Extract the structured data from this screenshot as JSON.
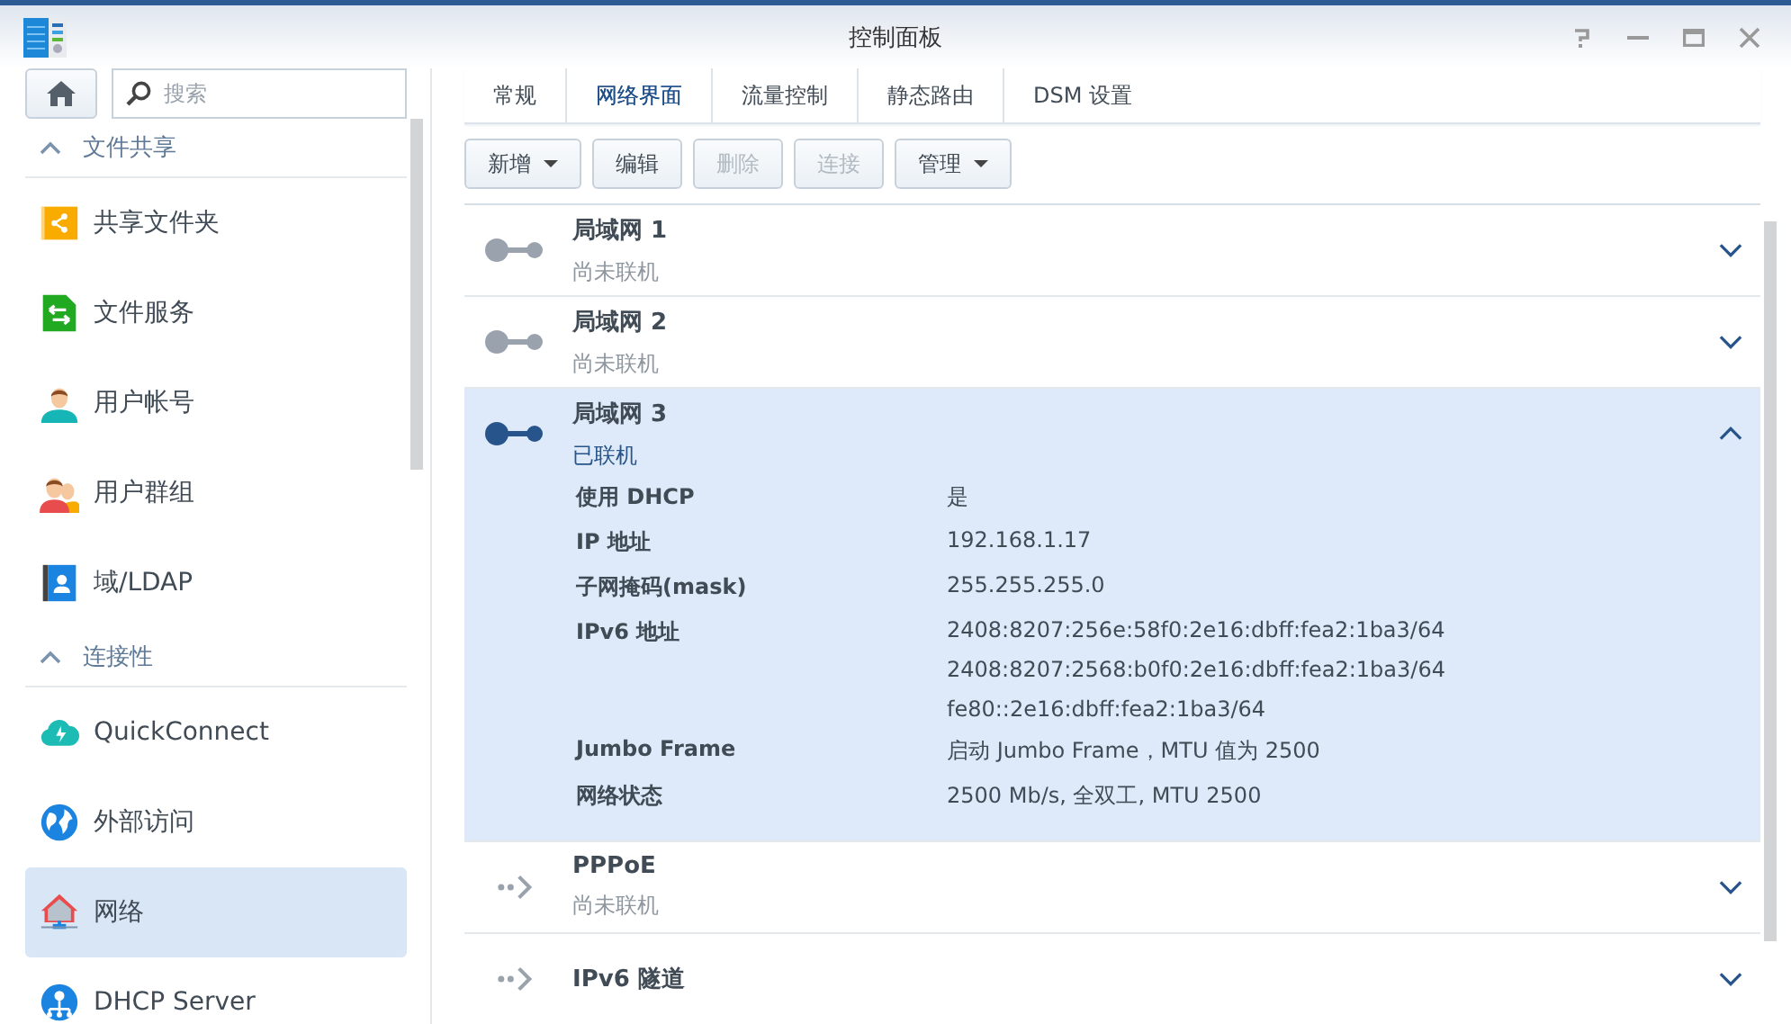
{
  "window": {
    "title": "控制面板"
  },
  "sidebar": {
    "search": {
      "placeholder": "搜索"
    },
    "sections": [
      {
        "title": "文件共享",
        "expanded": true,
        "items": [
          {
            "label": "共享文件夹",
            "kind": "folder",
            "selected": false
          },
          {
            "label": "文件服务",
            "kind": "fileservice",
            "selected": false
          },
          {
            "label": "用户帐号",
            "kind": "user",
            "selected": false
          },
          {
            "label": "用户群组",
            "kind": "group",
            "selected": false
          },
          {
            "label": "域/LDAP",
            "kind": "ldap",
            "selected": false
          }
        ]
      },
      {
        "title": "连接性",
        "expanded": true,
        "items": [
          {
            "label": "QuickConnect",
            "kind": "cloud",
            "selected": false
          },
          {
            "label": "外部访问",
            "kind": "globe",
            "selected": false
          },
          {
            "label": "网络",
            "kind": "network",
            "selected": true
          },
          {
            "label": "DHCP Server",
            "kind": "dhcp",
            "selected": false
          }
        ]
      }
    ]
  },
  "tabs": [
    {
      "label": "常规",
      "selected": false
    },
    {
      "label": "网络界面",
      "selected": true
    },
    {
      "label": "流量控制",
      "selected": false
    },
    {
      "label": "静态路由",
      "selected": false
    },
    {
      "label": "DSM 设置",
      "selected": false
    }
  ],
  "toolbar": [
    {
      "label": "新增",
      "dropdown": true,
      "disabled": false
    },
    {
      "label": "编辑",
      "dropdown": false,
      "disabled": false
    },
    {
      "label": "删除",
      "dropdown": false,
      "disabled": true
    },
    {
      "label": "连接",
      "dropdown": false,
      "disabled": true
    },
    {
      "label": "管理",
      "dropdown": true,
      "disabled": false
    }
  ],
  "interfaces": [
    {
      "name": "局域网 1",
      "kind": "lan",
      "status": "尚未联机",
      "connected": false,
      "expanded": false
    },
    {
      "name": "局域网 2",
      "kind": "lan",
      "status": "尚未联机",
      "connected": false,
      "expanded": false
    },
    {
      "name": "局域网 3",
      "kind": "lan",
      "status": "已联机",
      "connected": true,
      "expanded": true,
      "details": [
        {
          "label": "使用 DHCP",
          "values": [
            "是"
          ]
        },
        {
          "label": "IP 地址",
          "values": [
            "192.168.1.17"
          ]
        },
        {
          "label": "子网掩码(mask)",
          "values": [
            "255.255.255.0"
          ]
        },
        {
          "label": "IPv6 地址",
          "values": [
            "2408:8207:256e:58f0:2e16:dbff:fea2:1ba3/64",
            "2408:8207:2568:b0f0:2e16:dbff:fea2:1ba3/64",
            "fe80::2e16:dbff:fea2:1ba3/64"
          ]
        },
        {
          "label": "Jumbo Frame",
          "values": [
            "启动 Jumbo Frame，MTU 值为 2500"
          ]
        },
        {
          "label": "网络状态",
          "values": [
            "2500 Mb/s, 全双工, MTU 2500"
          ]
        }
      ]
    },
    {
      "name": "PPPoE",
      "kind": "tunnel",
      "status": "尚未联机",
      "connected": false,
      "expanded": false
    },
    {
      "name": "IPv6 隧道",
      "kind": "tunnel",
      "connected": false,
      "expanded": false
    }
  ]
}
